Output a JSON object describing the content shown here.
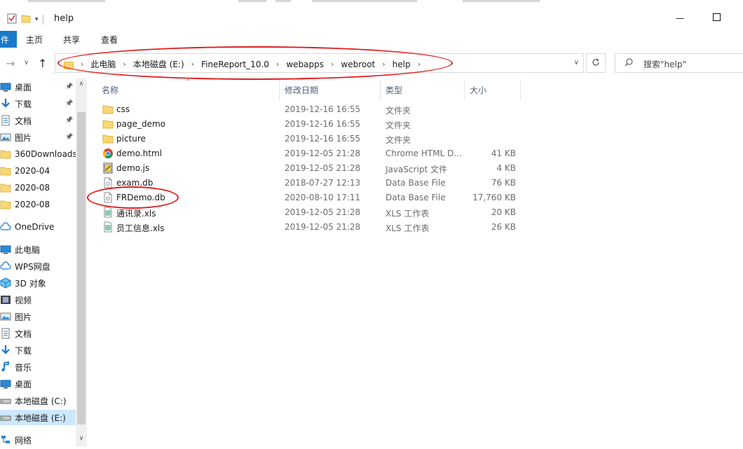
{
  "window": {
    "title": "help",
    "minimize_glyph": "—",
    "maximize_glyph": "☐"
  },
  "ribbon": {
    "file_tab": "件",
    "tabs": [
      "主页",
      "共享",
      "查看"
    ]
  },
  "address": {
    "crumbs": [
      "此电脑",
      "本地磁盘 (E:)",
      "FineReport_10.0",
      "webapps",
      "webroot",
      "help"
    ],
    "separator": "›"
  },
  "search": {
    "placeholder": "搜索\"help\""
  },
  "sidebar": {
    "items": [
      {
        "label": "桌面",
        "icon": "desktop-icon",
        "pinned": true
      },
      {
        "label": "下载",
        "icon": "download-icon",
        "pinned": true
      },
      {
        "label": "文档",
        "icon": "document-icon",
        "pinned": true
      },
      {
        "label": "图片",
        "icon": "picture-icon",
        "pinned": true
      },
      {
        "label": "360Downloads",
        "icon": "folder-icon",
        "pinned": false
      },
      {
        "label": "2020-04",
        "icon": "folder-icon",
        "pinned": false
      },
      {
        "label": "2020-08",
        "icon": "folder-icon",
        "pinned": false
      },
      {
        "label": "2020-08",
        "icon": "folder-icon",
        "pinned": false
      },
      {
        "label": "OneDrive",
        "icon": "cloud-icon",
        "pinned": false
      },
      {
        "label": "此电脑",
        "icon": "computer-icon",
        "pinned": false
      },
      {
        "label": "WPS网盘",
        "icon": "cloud-icon",
        "pinned": false
      },
      {
        "label": "3D 对象",
        "icon": "cube-icon",
        "pinned": false
      },
      {
        "label": "视频",
        "icon": "video-icon",
        "pinned": false
      },
      {
        "label": "图片",
        "icon": "picture-icon",
        "pinned": false
      },
      {
        "label": "文档",
        "icon": "document-icon",
        "pinned": false
      },
      {
        "label": "下载",
        "icon": "download-icon",
        "pinned": false
      },
      {
        "label": "音乐",
        "icon": "music-icon",
        "pinned": false
      },
      {
        "label": "桌面",
        "icon": "desktop-icon",
        "pinned": false
      },
      {
        "label": "本地磁盘 (C:)",
        "icon": "drive-icon",
        "pinned": false
      },
      {
        "label": "本地磁盘 (E:)",
        "icon": "drive-icon",
        "pinned": false,
        "selected": true
      },
      {
        "label": "网络",
        "icon": "network-icon",
        "pinned": false
      }
    ]
  },
  "columns": {
    "name": "名称",
    "date": "修改日期",
    "type": "类型",
    "size": "大小"
  },
  "files": [
    {
      "name": "css",
      "date": "2019-12-16 16:55",
      "type": "文件夹",
      "size": "",
      "icon": "folder-icon"
    },
    {
      "name": "page_demo",
      "date": "2019-12-16 16:55",
      "type": "文件夹",
      "size": "",
      "icon": "folder-icon"
    },
    {
      "name": "picture",
      "date": "2019-12-16 16:55",
      "type": "文件夹",
      "size": "",
      "icon": "folder-icon"
    },
    {
      "name": "demo.html",
      "date": "2019-12-05 21:28",
      "type": "Chrome HTML D...",
      "size": "41 KB",
      "icon": "chrome-icon"
    },
    {
      "name": "demo.js",
      "date": "2019-12-05 21:28",
      "type": "JavaScript 文件",
      "size": "4 KB",
      "icon": "js-file-icon"
    },
    {
      "name": "exam.db",
      "date": "2018-07-27 12:13",
      "type": "Data Base File",
      "size": "76 KB",
      "icon": "db-file-icon"
    },
    {
      "name": "FRDemo.db",
      "date": "2020-08-10 17:11",
      "type": "Data Base File",
      "size": "17,760 KB",
      "icon": "db-file-icon"
    },
    {
      "name": "通讯录.xls",
      "date": "2019-12-05 21:28",
      "type": "XLS 工作表",
      "size": "20 KB",
      "icon": "xls-file-icon"
    },
    {
      "name": "员工信息.xls",
      "date": "2019-12-05 21:28",
      "type": "XLS 工作表",
      "size": "26 KB",
      "icon": "xls-file-icon"
    }
  ],
  "colors": {
    "annotation": "#e02020",
    "selection": "#cce8ff",
    "folder": "#f8d775",
    "file_tab": "#1979ca"
  }
}
